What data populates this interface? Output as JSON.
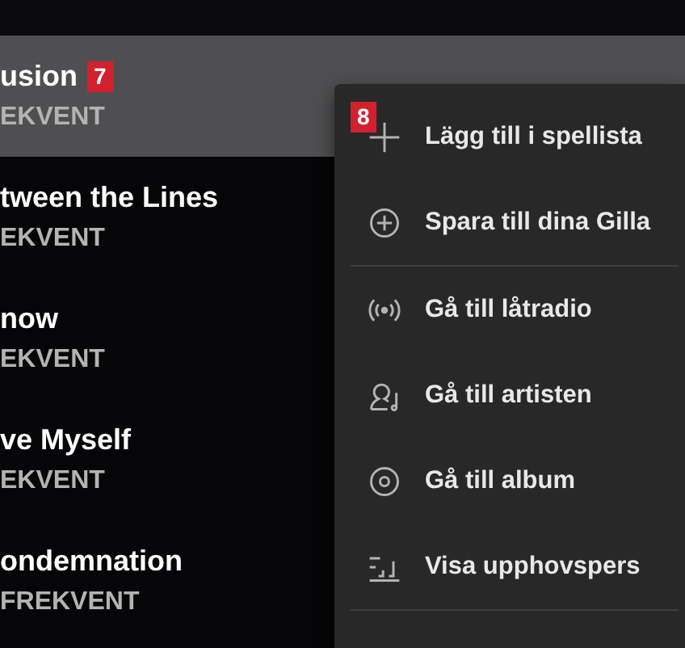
{
  "tracks": [
    {
      "title": "usion",
      "subtitle": "EKVENT",
      "selected": true,
      "badge": "7"
    },
    {
      "title": "tween the Lines",
      "subtitle": "EKVENT",
      "selected": false
    },
    {
      "title": "now",
      "subtitle": "EKVENT",
      "selected": false
    },
    {
      "title": "ve Myself",
      "subtitle": "EKVENT",
      "selected": false
    },
    {
      "title": "ondemnation",
      "subtitle": "FREKVENT",
      "selected": false
    }
  ],
  "context_menu": {
    "badge": "8",
    "sections": [
      {
        "items": [
          {
            "label": "Lägg till i spellista"
          },
          {
            "label": "Spara till dina Gilla"
          }
        ]
      },
      {
        "items": [
          {
            "label": "Gå till låtradio"
          },
          {
            "label": "Gå till artisten"
          },
          {
            "label": "Gå till album"
          },
          {
            "label": "Visa upphovspers"
          }
        ]
      }
    ]
  }
}
